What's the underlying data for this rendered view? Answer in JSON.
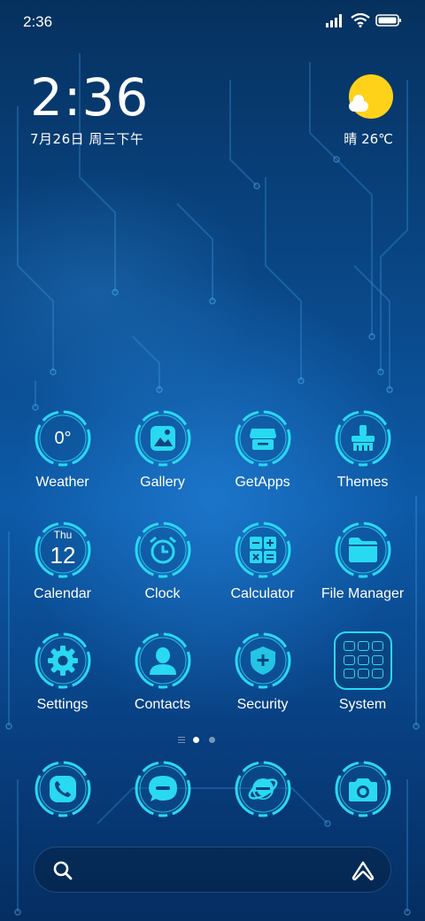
{
  "status_bar": {
    "time": "2:36",
    "signal": "signal-icon",
    "wifi": "wifi-icon",
    "battery": "battery-icon"
  },
  "clock_widget": {
    "time": "2:36",
    "date": "7月26日 周三下午"
  },
  "weather_widget": {
    "icon": "sun-cloud-icon",
    "text": "晴 26℃"
  },
  "apps": [
    {
      "label": "Weather",
      "icon": "weather-icon",
      "glyph_text": "0°"
    },
    {
      "label": "Gallery",
      "icon": "gallery-icon"
    },
    {
      "label": "GetApps",
      "icon": "store-icon"
    },
    {
      "label": "Themes",
      "icon": "brush-icon"
    },
    {
      "label": "Calendar",
      "icon": "calendar-icon",
      "day": "Thu",
      "date": "12"
    },
    {
      "label": "Clock",
      "icon": "alarm-clock-icon"
    },
    {
      "label": "Calculator",
      "icon": "calculator-icon"
    },
    {
      "label": "File Manager",
      "icon": "folder-icon"
    },
    {
      "label": "Settings",
      "icon": "gear-icon"
    },
    {
      "label": "Contacts",
      "icon": "person-icon"
    },
    {
      "label": "Security",
      "icon": "shield-icon"
    },
    {
      "label": "System",
      "icon": "system-folder-icon"
    }
  ],
  "page_indicator": {
    "pages": 2,
    "current": 1
  },
  "dock": [
    {
      "icon": "phone-icon"
    },
    {
      "icon": "message-icon"
    },
    {
      "icon": "browser-icon"
    },
    {
      "icon": "camera-icon"
    }
  ],
  "search_bar": {
    "search_icon": "search-icon",
    "assistant_icon": "assistant-icon"
  },
  "colors": {
    "accent": "#29d9f2",
    "background": "#0a4a8c",
    "sun": "#ffd21a"
  }
}
